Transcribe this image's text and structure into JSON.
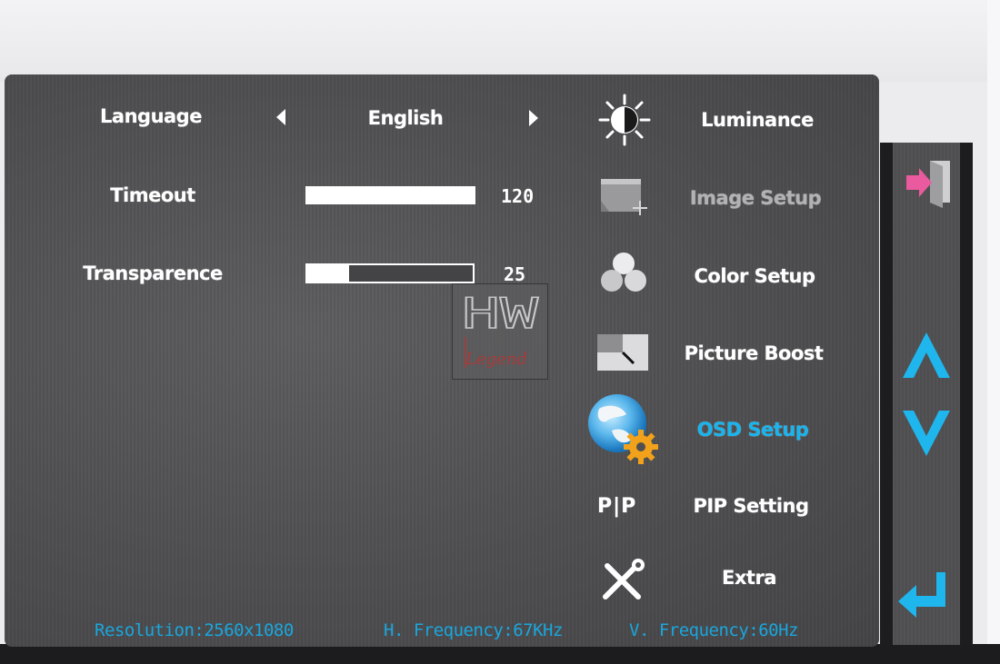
{
  "osd": {
    "settings": {
      "language": {
        "label": "Language",
        "value": "English"
      },
      "timeout": {
        "label": "Timeout",
        "value": "120",
        "level": 1.0
      },
      "transparence": {
        "label": "Transparence",
        "value": "25",
        "level": 0.25
      }
    },
    "menu": {
      "items": [
        {
          "label": "Luminance",
          "icon": "brightness-icon",
          "state": "normal"
        },
        {
          "label": "Image Setup",
          "icon": "image-setup-icon",
          "state": "disabled"
        },
        {
          "label": "Color Setup",
          "icon": "color-setup-icon",
          "state": "normal"
        },
        {
          "label": "Picture Boost",
          "icon": "picture-boost-icon",
          "state": "normal"
        },
        {
          "label": "OSD Setup",
          "icon": "osd-setup-icon",
          "state": "selected"
        },
        {
          "label": "PIP Setting",
          "icon_text": "P|P",
          "state": "normal"
        },
        {
          "label": "Extra",
          "icon": "tools-icon",
          "state": "normal"
        }
      ]
    },
    "status_bar": {
      "resolution": "Resolution:2560x1080",
      "h_frequency": "H. Frequency:67KHz",
      "v_frequency": "V. Frequency:60Hz"
    },
    "side_nav": {
      "exit_icon": "exit-icon",
      "up_icon": "up-arrow-icon",
      "down_icon": "down-arrow-icon",
      "enter_icon": "enter-icon"
    },
    "watermark": {
      "line1": "HW",
      "line2": "Legend"
    },
    "colors": {
      "accent": "#19b4ee",
      "panel": "#505052",
      "text": "#ffffff",
      "disabled": "#b2b2b4"
    }
  }
}
